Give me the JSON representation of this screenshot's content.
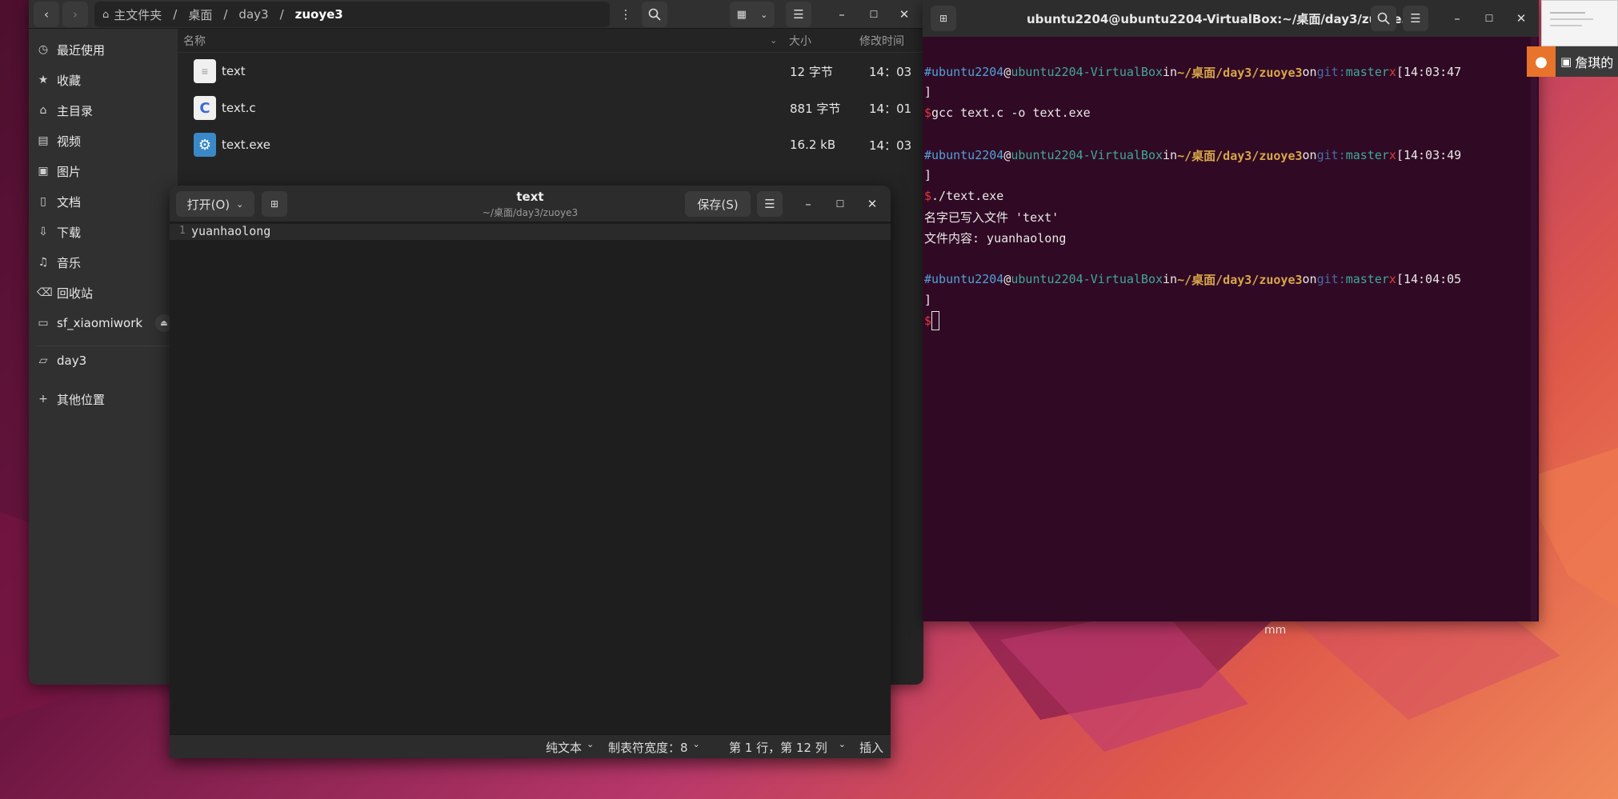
{
  "file_manager": {
    "breadcrumb": [
      "主文件夹",
      "桌面",
      "day3",
      "zuoye3"
    ],
    "sidebar": [
      {
        "label": "最近使用",
        "icon": "clock-icon"
      },
      {
        "label": "收藏",
        "icon": "star-icon"
      },
      {
        "label": "主目录",
        "icon": "home-icon"
      },
      {
        "label": "视频",
        "icon": "video-icon"
      },
      {
        "label": "图片",
        "icon": "image-icon"
      },
      {
        "label": "文档",
        "icon": "document-icon"
      },
      {
        "label": "下载",
        "icon": "download-icon"
      },
      {
        "label": "音乐",
        "icon": "music-icon"
      },
      {
        "label": "回收站",
        "icon": "trash-icon"
      },
      {
        "label": "sf_xiaomiwork",
        "icon": "drive-icon"
      },
      {
        "label": "day3",
        "icon": "folder-icon"
      },
      {
        "label": "其他位置",
        "icon": "plus-icon"
      }
    ],
    "columns": {
      "name": "名称",
      "size": "大小",
      "modified": "修改时间"
    },
    "files": [
      {
        "name": "text",
        "size": "12 字节",
        "modified": "14：03",
        "icon": "text-file-icon"
      },
      {
        "name": "text.c",
        "size": "881 字节",
        "modified": "14：01",
        "icon": "c-source-icon"
      },
      {
        "name": "text.exe",
        "size": "16.2 kB",
        "modified": "14：03",
        "icon": "executable-icon"
      }
    ]
  },
  "editor": {
    "open_label": "打开(O)",
    "title": "text",
    "subtitle": "~/桌面/day3/zuoye3",
    "save_label": "保存(S)",
    "line_number": "1",
    "content": "yuanhaolong",
    "status": {
      "syntax": "纯文本",
      "tab_width": "制表符宽度：8",
      "position": "第 1 行，第 12 列",
      "mode": "插入"
    }
  },
  "terminal": {
    "title": "ubuntu2204@ubuntu2204-VirtualBox:~/桌面/day3/zuoye3",
    "prompt": {
      "hash": "#",
      "user": "ubuntu2204",
      "at": "@",
      "host": "ubuntu2204-VirtualBox",
      "in": "in",
      "path": "~/桌面/day3/zuoye3",
      "on": "on",
      "git": "git:",
      "branch": "master",
      "dirty": "x",
      "close_bracket": "]",
      "dollar": "$"
    },
    "blocks": [
      {
        "time": "[14:03:47",
        "command": "gcc text.c -o text.exe",
        "output": []
      },
      {
        "time": "[14:03:49",
        "command": "./text.exe",
        "output": [
          "名字已写入文件 'text'",
          "文件内容: yuanhaolong"
        ]
      },
      {
        "time": "[14:04:05",
        "command": "",
        "output": []
      }
    ]
  },
  "overlay": {
    "label": "詹琪的"
  },
  "desktop": {
    "label": "mm"
  },
  "colors": {
    "terminal_bg": "#300a24",
    "editor_bg": "#1e1e1e",
    "accent_orange": "#e8732a"
  }
}
